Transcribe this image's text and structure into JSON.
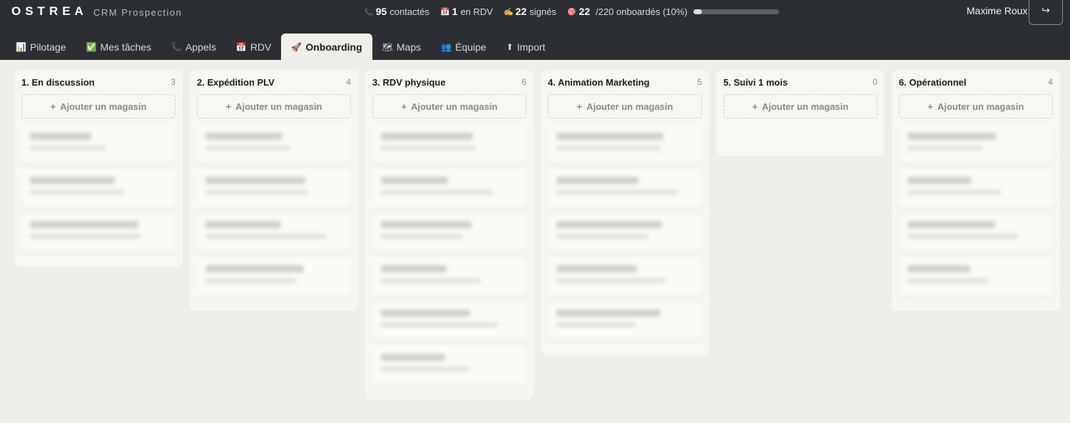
{
  "header": {
    "brand": "OSTREA",
    "subtitle": "CRM Prospection",
    "user_name": "Maxime Roux",
    "logout_icon": "↪"
  },
  "stats": {
    "contacted": {
      "icon": "📞",
      "count": "95",
      "label": "contactés"
    },
    "rdv": {
      "icon": "📅",
      "count": "1",
      "label": "en RDV"
    },
    "signed": {
      "icon": "✍",
      "count": "22",
      "label": "signés"
    },
    "onboarded": {
      "icon": "🎯",
      "count": "22",
      "label": "/220 onboardés (10%)",
      "progress": 0.1
    }
  },
  "tabs": [
    {
      "icon": "📊",
      "label": "Pilotage"
    },
    {
      "icon": "✅",
      "label": "Mes tâches"
    },
    {
      "icon": "📞",
      "label": "Appels"
    },
    {
      "icon": "📅",
      "label": "RDV"
    },
    {
      "icon": "🚀",
      "label": "Onboarding"
    },
    {
      "icon": "🗺",
      "label": "Maps"
    },
    {
      "icon": "👥",
      "label": "Équipe"
    },
    {
      "icon": "⬆",
      "label": "Import"
    }
  ],
  "active_tab": "Onboarding",
  "add_label": "Ajouter un magasin",
  "columns": [
    {
      "title": "1. En discussion",
      "count": "3"
    },
    {
      "title": "2. Expédition PLV",
      "count": "4"
    },
    {
      "title": "3. RDV physique",
      "count": "6"
    },
    {
      "title": "4. Animation Marketing",
      "count": "5"
    },
    {
      "title": "5. Suivi 1 mois",
      "count": "0"
    },
    {
      "title": "6. Opérationnel",
      "count": "4"
    }
  ]
}
